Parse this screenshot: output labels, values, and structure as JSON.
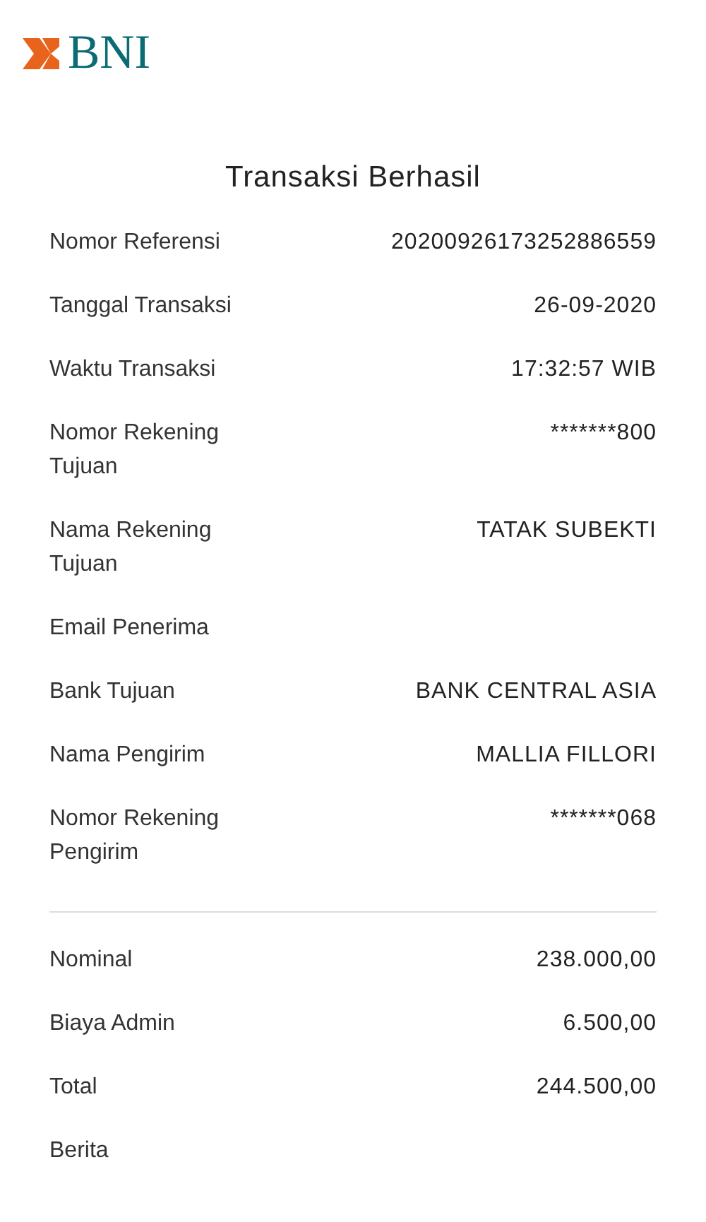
{
  "logo": {
    "text": "BNI"
  },
  "title": "Transaksi Berhasil",
  "details": [
    {
      "label": "Nomor Referensi",
      "value": "20200926173252886559"
    },
    {
      "label": "Tanggal Transaksi",
      "value": "26-09-2020"
    },
    {
      "label": "Waktu Transaksi",
      "value": "17:32:57 WIB"
    },
    {
      "label": "Nomor Rekening Tujuan",
      "value": "*******800"
    },
    {
      "label": "Nama Rekening Tujuan",
      "value": "TATAK SUBEKTI"
    },
    {
      "label": "Email Penerima"
    },
    {
      "label": "Bank Tujuan",
      "value": "BANK CENTRAL ASIA"
    },
    {
      "label": "Nama Pengirim",
      "value": "MALLIA FILLORI"
    },
    {
      "label": "Nomor Rekening Pengirim",
      "value": "*******068"
    }
  ],
  "amounts": [
    {
      "label": "Nominal",
      "value": "238.000,00"
    },
    {
      "label": "Biaya Admin",
      "value": "6.500,00"
    },
    {
      "label": "Total",
      "value": "244.500,00"
    },
    {
      "label": "Berita"
    }
  ]
}
